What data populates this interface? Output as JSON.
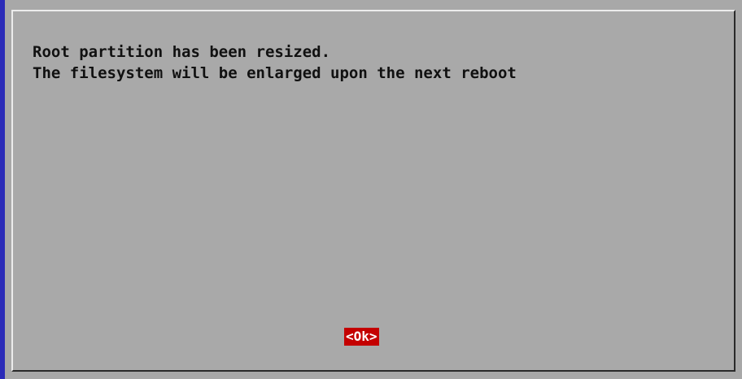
{
  "colors": {
    "screen_background": "#a8a8a8",
    "edge_accent": "#2b2bb8",
    "button_background": "#c40000",
    "button_text": "#ffffff",
    "text": "#111111"
  },
  "dialog": {
    "message_line_1": "Root partition has been resized.",
    "message_line_2": "The filesystem will be enlarged upon the next reboot",
    "ok_button_label": "<Ok>"
  }
}
